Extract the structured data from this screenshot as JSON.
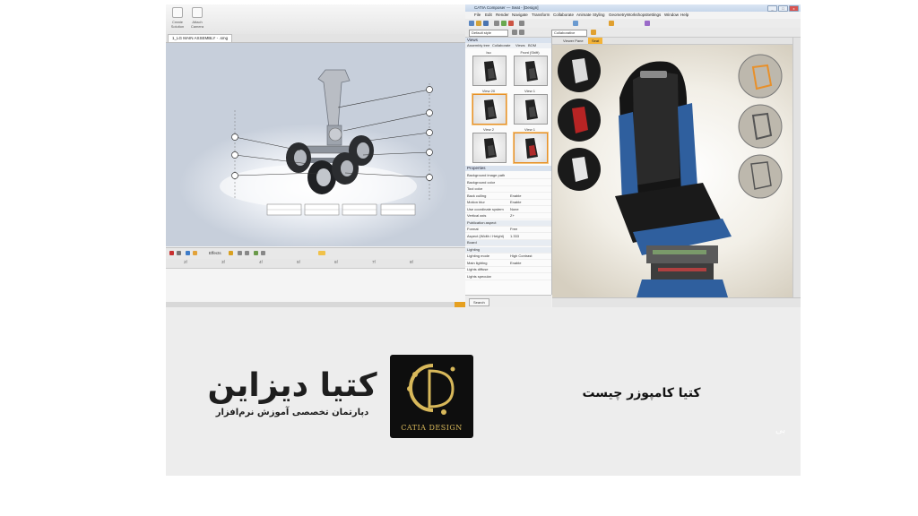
{
  "left_app": {
    "ribbon": {
      "create_btn": "Create Solution",
      "attach_btn": "Attach Camera"
    },
    "document_tab": "1_LG MAIN ASSEMBLY - .smg",
    "toolbar": {
      "effects_label": "Effects"
    },
    "timeline": {
      "ticks": [
        "2f",
        "3f",
        "4f",
        "5f",
        "6f",
        "7f",
        "8f"
      ]
    },
    "callout_labels": [
      "A",
      "B",
      "C",
      "D",
      "E",
      "F",
      "G",
      "H",
      "I"
    ],
    "bom_tables": [
      "Description | PartNo | Qty",
      "Description | PartNo | Qty",
      "Description | PartNo | Qty",
      "Description | PartNo | Qty"
    ]
  },
  "right_app": {
    "window_title": "CATIA Composer — Seat - [Design]",
    "window_buttons": [
      "_",
      "□",
      "x"
    ],
    "menu": [
      "File",
      "Edit",
      "Render",
      "Navigate",
      "Transform",
      "Collaborate",
      "Animate",
      "Styling",
      "Geometry",
      "Workshops",
      "Settings",
      "Window",
      "Help"
    ],
    "style_combo": "Default style",
    "collab_combo": "Collaborative",
    "panes": {
      "views_title": "Views",
      "views_tabs": [
        "Assembly tree",
        "Collaborate",
        "Views",
        "BOM"
      ],
      "views": [
        {
          "label": "Iso",
          "selected": false
        },
        {
          "label": "Front (Shift)",
          "selected": false
        },
        {
          "label": "View 20",
          "selected": true
        },
        {
          "label": "View 1",
          "selected": false
        },
        {
          "label": "View 2",
          "selected": false
        },
        {
          "label": "View 1",
          "selected": true
        },
        {
          "label": "View 4",
          "selected": false
        },
        {
          "label": "View 5",
          "selected": false
        }
      ],
      "properties_title": "Properties",
      "properties": [
        {
          "k": "Background image path",
          "v": "",
          "group": false
        },
        {
          "k": "Background color",
          "v": "",
          "group": false
        },
        {
          "k": "Tool color",
          "v": "",
          "group": false
        },
        {
          "k": "Back culling",
          "v": "Enable",
          "group": false
        },
        {
          "k": "Motion blur",
          "v": "Enable",
          "group": false
        },
        {
          "k": "Use coordinate system",
          "v": "None",
          "group": false
        },
        {
          "k": "Vertical axis",
          "v": "Z+",
          "group": false
        },
        {
          "k": "Publication aspect",
          "v": "",
          "group": true
        },
        {
          "k": "Format",
          "v": "Free",
          "group": false
        },
        {
          "k": "Aspect (Width / Height)",
          "v": "1.333",
          "group": false
        },
        {
          "k": "Board",
          "v": "",
          "group": true
        },
        {
          "k": "Lighting",
          "v": "",
          "group": true
        },
        {
          "k": "Lighting mode",
          "v": "High Contrast",
          "group": false
        },
        {
          "k": "Main lighting",
          "v": "Enable",
          "group": false
        },
        {
          "k": "Lights diffuse",
          "v": "",
          "group": false
        },
        {
          "k": "Lights specular",
          "v": "",
          "group": false
        }
      ],
      "search_btn": "Search"
    },
    "viewport_tabs": [
      "Viewer Pane",
      "Seat"
    ]
  },
  "banner": {
    "brand_name": "کتیا دیزاین",
    "brand_tagline": "دپارتمان تخصصی آموزش نرم‌افزار",
    "logo_caption": "CATIA DESIGN",
    "heading": "کتیا کامپوزر چیست",
    "watermark": "بی"
  },
  "colors": {
    "accent_orange": "#f3b338",
    "logo_gold": "#d8b85a",
    "seat_black": "#151515",
    "seat_blue": "#2f5f9e"
  }
}
